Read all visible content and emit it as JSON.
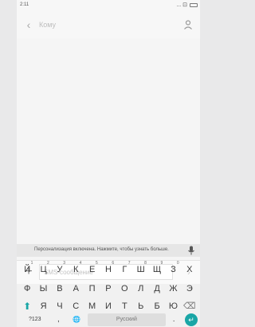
{
  "status": {
    "time": "2:11",
    "icons": "... ⊡"
  },
  "header": {
    "to_label": "Кому"
  },
  "compose": {
    "placeholder": "SMS-сообщение"
  },
  "keyboard": {
    "suggestion": "Персонализация включена. Нажмите, чтобы узнать больше.",
    "row1": [
      {
        "k": "Й",
        "h": "1"
      },
      {
        "k": "Ц",
        "h": "2"
      },
      {
        "k": "У",
        "h": "3"
      },
      {
        "k": "К",
        "h": "4"
      },
      {
        "k": "Е",
        "h": "5"
      },
      {
        "k": "Н",
        "h": "6"
      },
      {
        "k": "Г",
        "h": "7"
      },
      {
        "k": "Ш",
        "h": "8"
      },
      {
        "k": "Щ",
        "h": "9"
      },
      {
        "k": "З",
        "h": "0"
      },
      {
        "k": "Х",
        "h": ""
      }
    ],
    "row2": [
      "Ф",
      "Ы",
      "В",
      "А",
      "П",
      "Р",
      "О",
      "Л",
      "Д",
      "Ж",
      "Э"
    ],
    "row3": [
      "Я",
      "Ч",
      "С",
      "М",
      "И",
      "Т",
      "Ь",
      "Б",
      "Ю"
    ],
    "bottom": {
      "symbols": "?123",
      "comma": ",",
      "space": "Русский",
      "period": "."
    }
  },
  "colors": {
    "accent": "#1aa6a6"
  }
}
